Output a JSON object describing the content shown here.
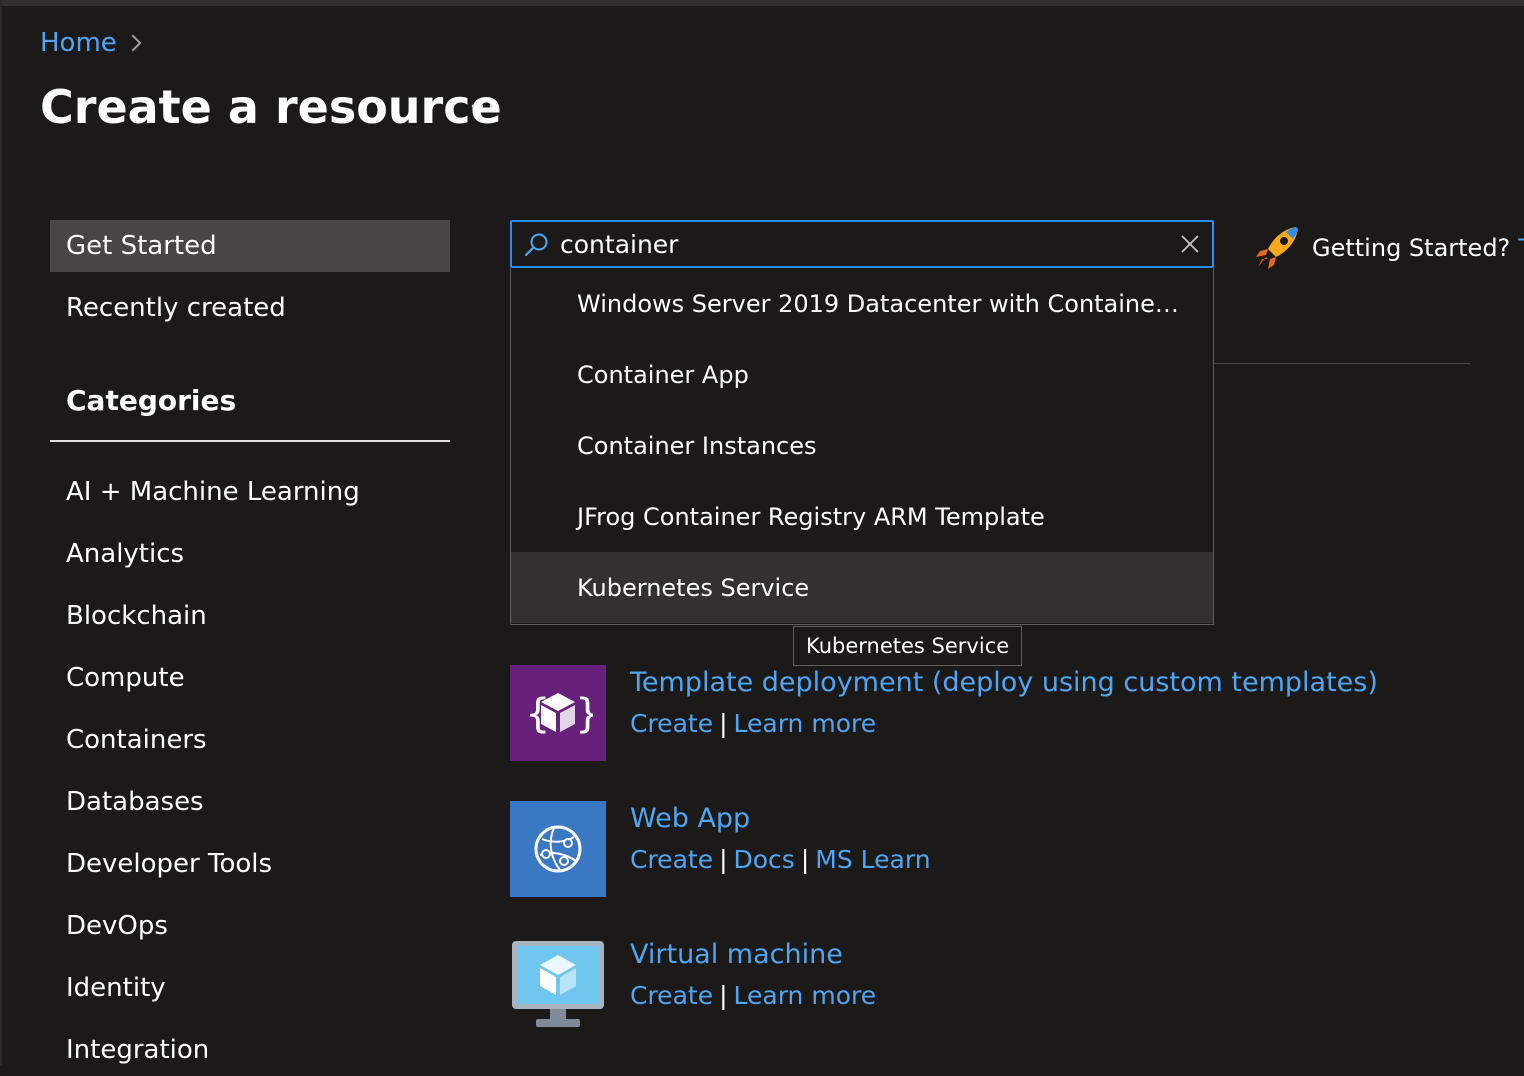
{
  "breadcrumb": {
    "home": "Home"
  },
  "page": {
    "title": "Create a resource",
    "more": "···"
  },
  "sidebar": {
    "primary": [
      {
        "label": "Get Started",
        "selected": true
      },
      {
        "label": "Recently created",
        "selected": false
      }
    ],
    "categories_heading": "Categories",
    "categories": [
      "AI + Machine Learning",
      "Analytics",
      "Blockchain",
      "Compute",
      "Containers",
      "Databases",
      "Developer Tools",
      "DevOps",
      "Identity",
      "Integration"
    ]
  },
  "search": {
    "value": "container",
    "suggestions": [
      "Windows Server 2019 Datacenter with Containe…",
      "Container App",
      "Container Instances",
      "JFrog Container Registry ARM Template",
      "Kubernetes Service"
    ],
    "highlighted_index": 4,
    "tooltip": "Kubernetes Service"
  },
  "getting_started": {
    "text": "Getting Started?",
    "link": "Tr"
  },
  "resources": [
    {
      "title": "Template deployment (deploy using custom templates)",
      "links": [
        "Create",
        "Learn more"
      ],
      "icon": "template-deployment-icon",
      "tile_color": "#68217a"
    },
    {
      "title": "Web App",
      "links": [
        "Create",
        "Docs",
        "MS Learn"
      ],
      "icon": "web-app-icon",
      "tile_color": "#3a78c3"
    },
    {
      "title": "Virtual machine",
      "links": [
        "Create",
        "Learn more"
      ],
      "icon": "virtual-machine-icon",
      "tile_color": "#1b1a19"
    }
  ],
  "colors": {
    "background": "#1b1a19",
    "link": "#4ea6f5",
    "search_border": "#2f8cf0",
    "selected_item": "#484644"
  }
}
